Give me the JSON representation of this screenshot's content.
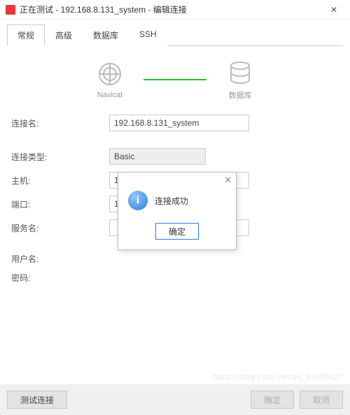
{
  "window": {
    "title": "正在测试 - 192.168.8.131_system - 编辑连接",
    "close": "✕"
  },
  "tabs": [
    "常规",
    "高级",
    "数据库",
    "SSH"
  ],
  "hero": {
    "left": "Navicat",
    "right": "数据库"
  },
  "form": {
    "name_label": "连接名:",
    "name_value": "192.168.8.131_system",
    "type_label": "连接类型:",
    "type_value": "Basic",
    "host_label": "主机:",
    "host_value": "192.168.8.131",
    "port_label": "端口:",
    "port_value": "1521",
    "service_label": "服务名:",
    "service_value": "",
    "user_label": "用户名:",
    "user_value": "",
    "pass_label": "密码:",
    "pass_value": ""
  },
  "modal": {
    "message": "连接成功",
    "ok": "确定"
  },
  "footer": {
    "test": "测试连接",
    "ok": "确定",
    "cancel": "取消"
  },
  "watermark": "https://blog.csdn.net/qq_32590627"
}
